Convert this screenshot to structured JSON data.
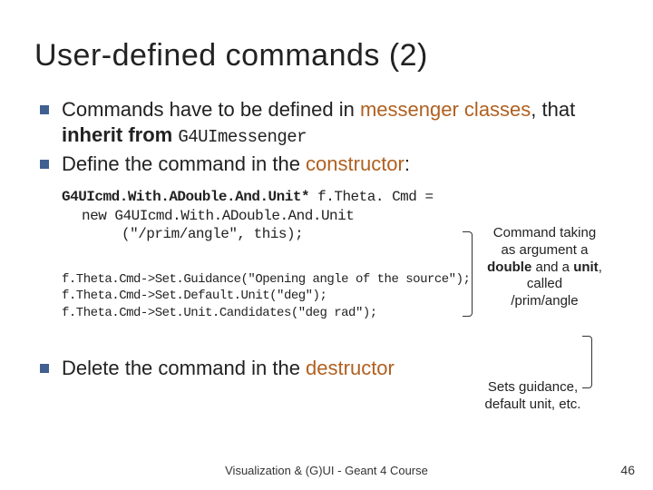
{
  "title": "User-defined commands (2)",
  "bullets": {
    "b1_a": "Commands have to be defined in ",
    "b1_accent": "messenger classes",
    "b1_b": ", that ",
    "b1_bold": "inherit from ",
    "b1_mono": "G4UImessenger",
    "b2_a": "Define the command in the ",
    "b2_accent": "constructor",
    "b2_b": ":",
    "b3_a": "Delete the command in the ",
    "b3_accent": "destructor"
  },
  "code": {
    "l1a": "G4UIcmd.With.ADouble.And.Unit*",
    "l1b": " f.Theta. Cmd =",
    "l2": "new G4UIcmd.With.ADouble.And.Unit",
    "l3": "(\"/prim/angle\", this);",
    "l5": "f.Theta.Cmd->Set.Guidance(\"Opening angle of the source\");",
    "l6": "f.Theta.Cmd->Set.Default.Unit(\"deg\");",
    "l7": "f.Theta.Cmd->Set.Unit.Candidates(\"deg rad\");"
  },
  "annot": {
    "a1_l1": "Command taking",
    "a1_l2": "as argument a",
    "a1_l3a": "double",
    "a1_l3b": " and a ",
    "a1_l3c": "unit",
    "a1_l3d": ",",
    "a1_l4": "called",
    "a1_l5": "/prim/angle",
    "a2_l1": "Sets guidance,",
    "a2_l2": "default unit, etc."
  },
  "footer": "Visualization & (G)UI - Geant 4 Course",
  "page": "46"
}
